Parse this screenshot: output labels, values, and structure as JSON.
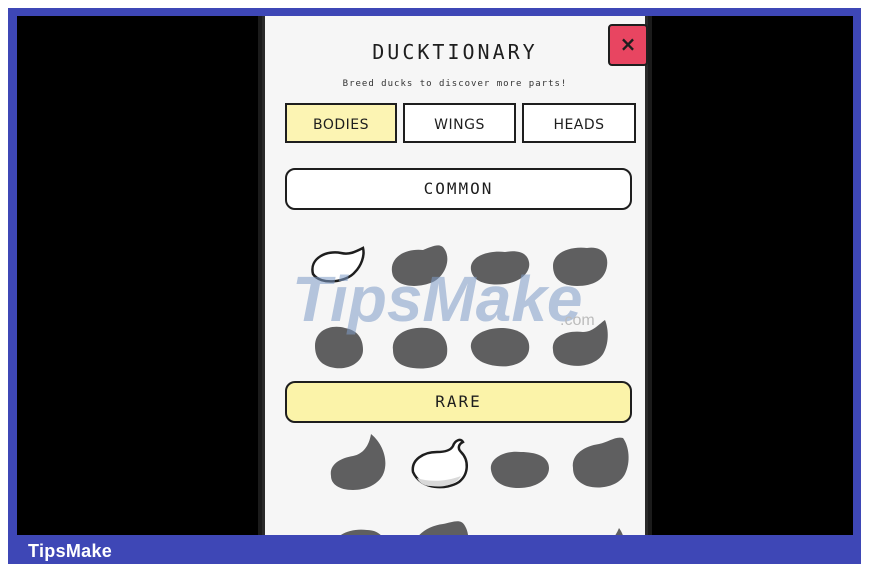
{
  "footer": {
    "brand": "TipsMake"
  },
  "dialog": {
    "title": "DUCKTIONARY",
    "subtitle": "Breed ducks to discover more parts!",
    "close_label": "×"
  },
  "tabs": [
    {
      "label": "BODIES",
      "active": true
    },
    {
      "label": "WINGS",
      "active": false
    },
    {
      "label": "HEADS",
      "active": false
    }
  ],
  "categories": {
    "common": {
      "label": "COMMON"
    },
    "rare": {
      "label": "RARE"
    }
  },
  "watermark": {
    "text": "TipsMake",
    "suffix": ".com"
  },
  "colors": {
    "frame": "#3e47b6",
    "active_tab": "#fcf4b3",
    "rare_banner": "#fbf3a9",
    "close_button": "#e84561",
    "locked_part": "#5f5f60"
  }
}
